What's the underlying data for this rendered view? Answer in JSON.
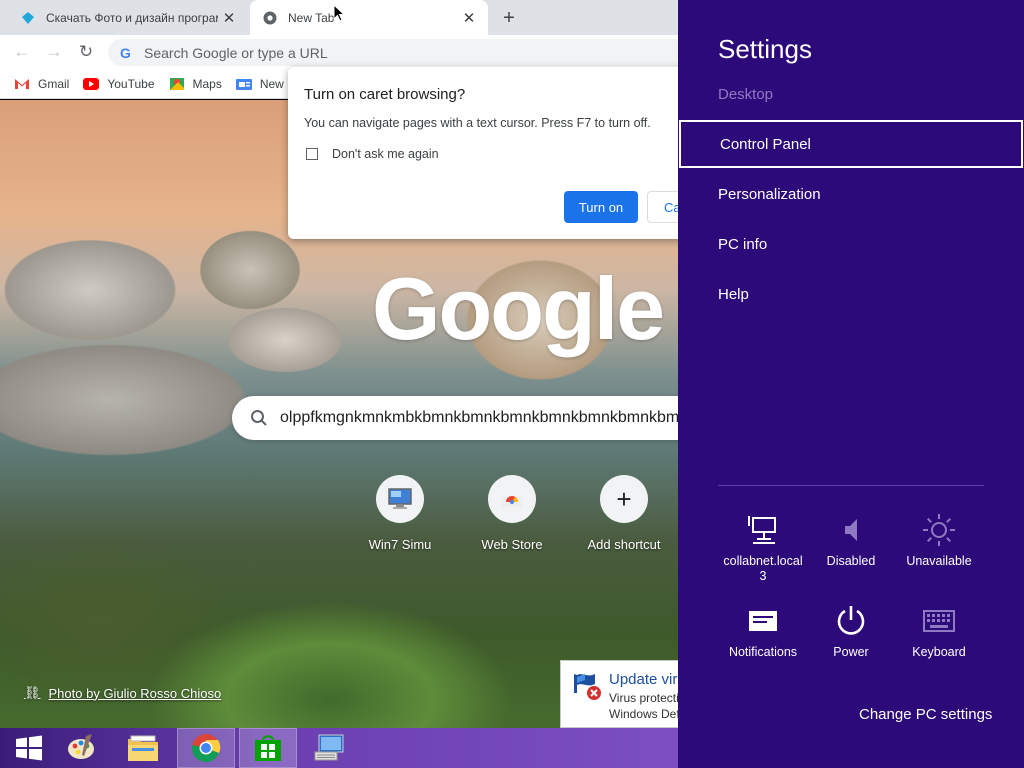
{
  "browser": {
    "tabs": [
      {
        "title": "Скачать Фото и дизайн програм",
        "icon": "canva-diamond-icon",
        "active": false
      },
      {
        "title": "New Tab",
        "icon": "chrome-icon",
        "active": true
      }
    ],
    "omnibox_placeholder": "Search Google or type a URL",
    "bookmarks": [
      {
        "label": "Gmail",
        "icon": "gmail-icon"
      },
      {
        "label": "YouTube",
        "icon": "youtube-icon"
      },
      {
        "label": "Maps",
        "icon": "maps-icon"
      },
      {
        "label": "New",
        "icon": "news-icon"
      }
    ]
  },
  "dialog": {
    "title": "Turn on caret browsing?",
    "body": "You can navigate pages with a text cursor. Press F7 to turn off.",
    "checkbox_label": "Don't ask me again",
    "primary_button": "Turn on",
    "secondary_button": "Ca"
  },
  "ntp": {
    "logo": "Google",
    "search_value": "olppfkmgnkmnkmbkbmnkbmnkbmnkbmnkbmnkbmnkbmnkbmnkb",
    "shortcuts": [
      {
        "label": "Win7 Simu",
        "icon": "monitor-icon"
      },
      {
        "label": "Web Store",
        "icon": "web-store-icon"
      },
      {
        "label": "Add shortcut",
        "icon": "plus-icon"
      }
    ],
    "attribution": "Photo by Giulio Rosso Chioso"
  },
  "defender": {
    "title": "Update vir",
    "line1": "Virus protecti",
    "line2": "Windows Def"
  },
  "taskbar": {
    "items": [
      "start-icon",
      "paint-icon",
      "file-explorer-icon",
      "chrome-icon",
      "store-icon",
      "remote-desktop-icon"
    ]
  },
  "settings": {
    "title": "Settings",
    "items": [
      {
        "label": "Desktop",
        "state": "dim"
      },
      {
        "label": "Control Panel",
        "state": "selected"
      },
      {
        "label": "Personalization",
        "state": "normal"
      },
      {
        "label": "PC info",
        "state": "normal"
      },
      {
        "label": "Help",
        "state": "normal"
      }
    ],
    "tiles": [
      {
        "label": "collabnet.local 3",
        "icon": "network-icon"
      },
      {
        "label": "Disabled",
        "icon": "volume-icon"
      },
      {
        "label": "Unavailable",
        "icon": "brightness-icon"
      },
      {
        "label": "Notifications",
        "icon": "notifications-icon"
      },
      {
        "label": "Power",
        "icon": "power-icon"
      },
      {
        "label": "Keyboard",
        "icon": "keyboard-icon"
      }
    ],
    "footer_link": "Change PC settings",
    "colors": {
      "background": "#2d0a7a",
      "dim_text": "#8e7ac2"
    }
  }
}
